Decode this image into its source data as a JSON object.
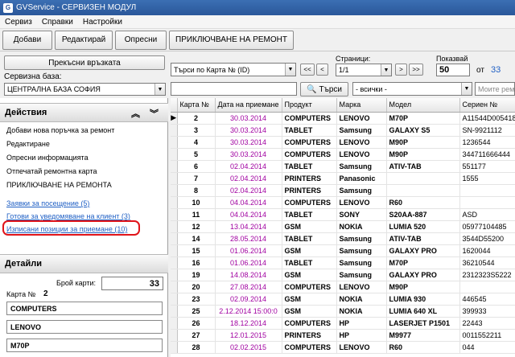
{
  "window": {
    "title": "GVService - СЕРВИЗЕН МОДУЛ"
  },
  "menu": [
    "Сервиз",
    "Справки",
    "Настройки"
  ],
  "toolbar": {
    "add": "Добави",
    "edit": "Редактирай",
    "refresh": "Опресни",
    "finish_repair": "ПРИКЛЮЧВАНЕ НА РЕМОНТ"
  },
  "controls": {
    "disconnect": "Прекъсни връзката",
    "service_base_label": "Сервизна база:",
    "service_base_value": "ЦЕНТРАЛНА БАЗА СОФИЯ",
    "search_by": "Търси по Карта № (ID)",
    "nav_first": "<<",
    "nav_prev": "<",
    "nav_next": ">",
    "nav_last": ">>",
    "pages_label": "Страници:",
    "pages_value": "1/1",
    "show_label": "Показвай",
    "show_value": "50",
    "of_label": "от",
    "total_value": "33",
    "search_btn": "Търси",
    "filter_all": "- всички -",
    "my_placeholder": "Моите рем"
  },
  "actions": {
    "title": "Действия",
    "items": [
      "Добави нова поръчка за ремонт",
      "Редактиране",
      "Опресни информацията",
      "Отпечатай ремонтна карта",
      "ПРИКЛЮЧВАНЕ НА РЕМОНТА"
    ],
    "links": [
      "Заявки за посещение (5)",
      "Готови за уведомяване на клиент (3)",
      "Изписани позиции за приемане (10)"
    ]
  },
  "details": {
    "title": "Детайли",
    "cards_label": "Брой карти:",
    "cards_value": "33",
    "card_no_label": "Карта №",
    "card_no_value": "2",
    "fields": [
      "COMPUTERS",
      "LENOVO",
      "M70P"
    ]
  },
  "table": {
    "columns": [
      "Карта №",
      "Дата на приемане",
      "Продукт",
      "Марка",
      "Модел",
      "Сериен №"
    ],
    "rows": [
      [
        "2",
        "30.03.2014",
        "COMPUTERS",
        "LENOVO",
        "M70P",
        "A11544D005418"
      ],
      [
        "3",
        "30.03.2014",
        "TABLET",
        "Samsung",
        "GALAXY S5",
        "SN-9921112"
      ],
      [
        "4",
        "30.03.2014",
        "COMPUTERS",
        "LENOVO",
        "M90P",
        "1236544"
      ],
      [
        "5",
        "30.03.2014",
        "COMPUTERS",
        "LENOVO",
        "M90P",
        "344711666444"
      ],
      [
        "6",
        "02.04.2014",
        "TABLET",
        "Samsung",
        "ATIV-TAB",
        "551177"
      ],
      [
        "7",
        "02.04.2014",
        "PRINTERS",
        "Panasonic",
        "",
        "1555"
      ],
      [
        "8",
        "02.04.2014",
        "PRINTERS",
        "Samsung",
        "",
        ""
      ],
      [
        "10",
        "04.04.2014",
        "COMPUTERS",
        "LENOVO",
        "R60",
        ""
      ],
      [
        "11",
        "04.04.2014",
        "TABLET",
        "SONY",
        "S20AA-887",
        "ASD"
      ],
      [
        "12",
        "13.04.2014",
        "GSM",
        "NOKIA",
        "LUMIA 520",
        "05977104485"
      ],
      [
        "14",
        "28.05.2014",
        "TABLET",
        "Samsung",
        "ATIV-TAB",
        "3544D55200"
      ],
      [
        "15",
        "01.06.2014",
        "GSM",
        "Samsung",
        "GALAXY PRO",
        "1620044"
      ],
      [
        "16",
        "01.06.2014",
        "TABLET",
        "Samsung",
        "M70P",
        "36210544"
      ],
      [
        "19",
        "14.08.2014",
        "GSM",
        "Samsung",
        "GALAXY PRO",
        "2312323S5222"
      ],
      [
        "20",
        "27.08.2014",
        "COMPUTERS",
        "LENOVO",
        "M90P",
        ""
      ],
      [
        "23",
        "02.09.2014",
        "GSM",
        "NOKIA",
        "LUMIA 930",
        "446545"
      ],
      [
        "25",
        "2.12.2014 15:00:0",
        "GSM",
        "NOKIA",
        "LUMIA 640 XL",
        "399933"
      ],
      [
        "26",
        "18.12.2014",
        "COMPUTERS",
        "HP",
        "LASERJET P1501",
        "22443"
      ],
      [
        "27",
        "12.01.2015",
        "PRINTERS",
        "HP",
        "M9977",
        "0011552211"
      ],
      [
        "28",
        "02.02.2015",
        "COMPUTERS",
        "LENOVO",
        "R60",
        "044"
      ]
    ],
    "selected_marker": "▶"
  }
}
